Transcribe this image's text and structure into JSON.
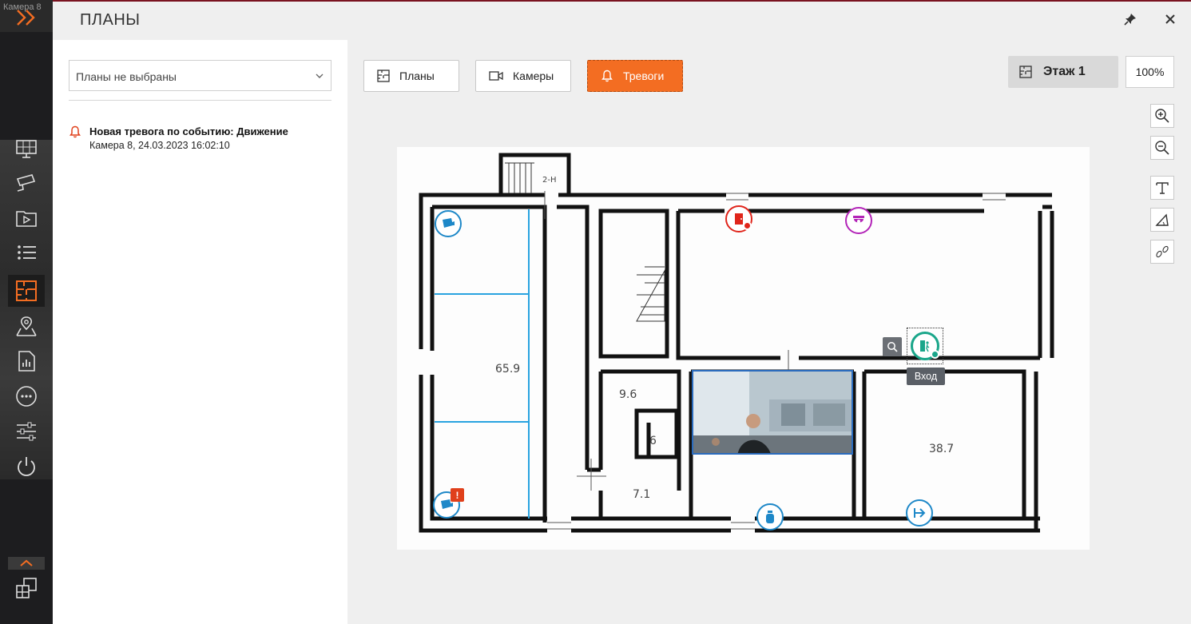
{
  "app": {
    "camera_label": "Камера 8",
    "panel_title": "ПЛАНЫ"
  },
  "rail": {
    "items": [
      {
        "name": "layouts",
        "icon": "monitor-grid-icon"
      },
      {
        "name": "cameras",
        "icon": "cctv-camera-icon"
      },
      {
        "name": "archive",
        "icon": "video-folder-icon"
      },
      {
        "name": "events",
        "icon": "list-icon"
      },
      {
        "name": "plans",
        "icon": "floor-plan-icon",
        "active": true
      },
      {
        "name": "map",
        "icon": "map-pin-icon"
      },
      {
        "name": "reports",
        "icon": "report-icon"
      },
      {
        "name": "more",
        "icon": "more-icon"
      },
      {
        "name": "settings",
        "icon": "sliders-icon"
      },
      {
        "name": "exit",
        "icon": "power-icon"
      }
    ],
    "accent": "#f36d22"
  },
  "left_panel": {
    "plan_select": {
      "value": "Планы не выбраны"
    },
    "alarms": [
      {
        "title": "Новая тревога по событию: Движение",
        "subtitle": "Камера 8, 24.03.2023 16:02:10"
      }
    ]
  },
  "toolbar": {
    "plans_label": "Планы",
    "cameras_label": "Камеры",
    "alarms_label": "Тревоги",
    "active_tab": "alarms",
    "floor_label": "Этаж 1",
    "zoom_label": "100%"
  },
  "plan": {
    "areas": [
      "65.9",
      "9.6",
      "6",
      "7.1",
      "38.7",
      "2-Н"
    ],
    "markers": [
      {
        "name": "camera-marker-top-left",
        "icon": "camera-icon",
        "color": "#1e88c8"
      },
      {
        "name": "camera-marker-bottom-left",
        "icon": "camera-icon",
        "color": "#1e88c8",
        "alarm": true
      },
      {
        "name": "door-sensor-marker",
        "icon": "door-icon",
        "color": "#e0251b"
      },
      {
        "name": "dome-camera-marker",
        "icon": "dome-camera-icon",
        "color": "#b325b8"
      },
      {
        "name": "entrance-marker",
        "icon": "exit-person-icon",
        "color": "#1aa68a",
        "selected": true
      },
      {
        "name": "extinguisher-marker",
        "icon": "extinguisher-icon",
        "color": "#1e88c8"
      },
      {
        "name": "exit-marker",
        "icon": "exit-arrow-icon",
        "color": "#1e88c8"
      }
    ],
    "tooltip": "Вход"
  }
}
